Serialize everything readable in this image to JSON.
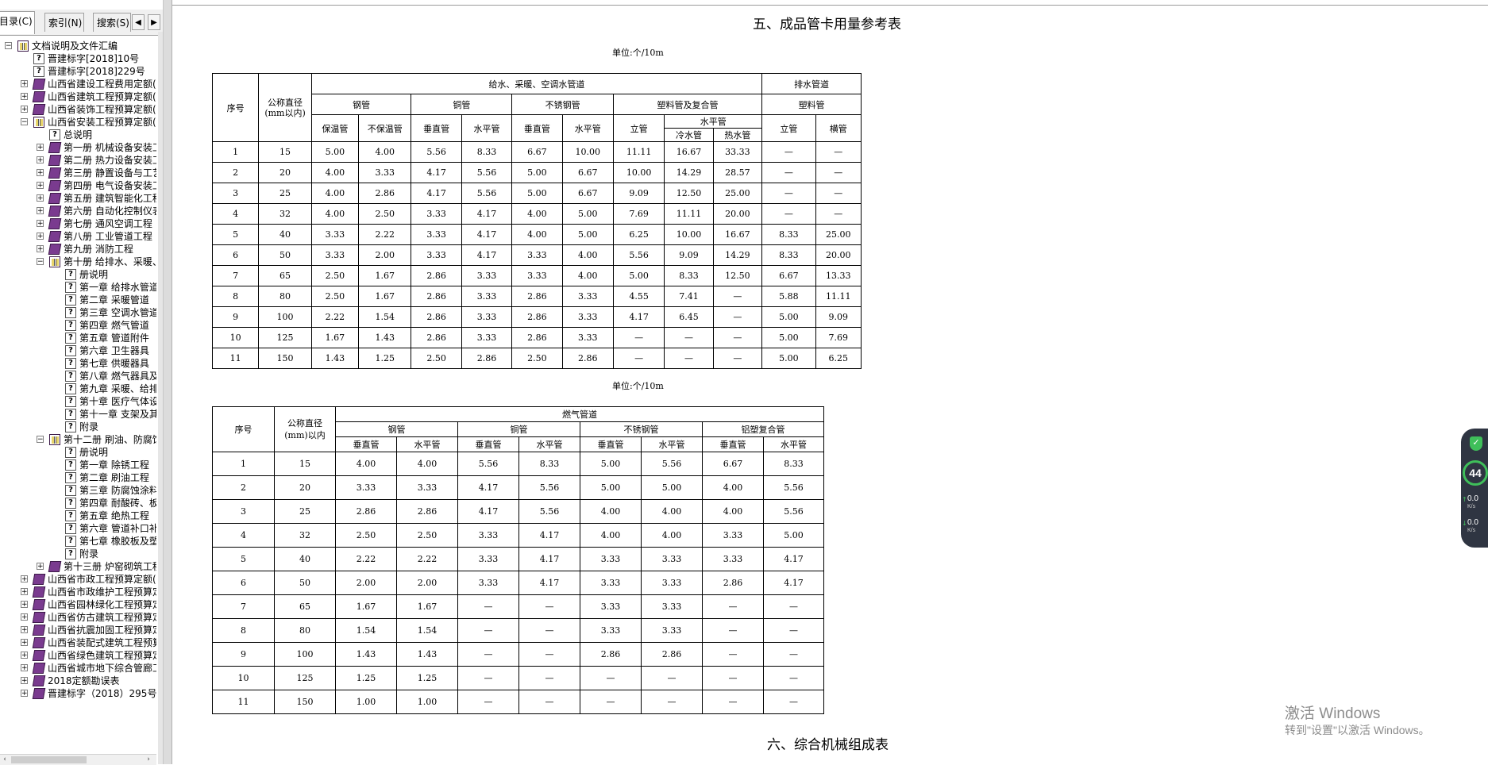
{
  "tabs": [
    {
      "label": "目录(C)",
      "active": true
    },
    {
      "label": "索引(N)",
      "active": false
    },
    {
      "label": "搜索(S)",
      "active": false
    }
  ],
  "tree": [
    {
      "level": 0,
      "toggle": "-",
      "icon": "book-open",
      "label": "文档说明及文件汇编"
    },
    {
      "level": 1,
      "toggle": "",
      "icon": "help",
      "label": "晋建标字[2018]10号"
    },
    {
      "level": 1,
      "toggle": "",
      "icon": "help",
      "label": "晋建标字[2018]229号"
    },
    {
      "level": 1,
      "toggle": "+",
      "icon": "book",
      "label": "山西省建设工程费用定额("
    },
    {
      "level": 1,
      "toggle": "+",
      "icon": "book",
      "label": "山西省建筑工程预算定额("
    },
    {
      "level": 1,
      "toggle": "+",
      "icon": "book",
      "label": "山西省装饰工程预算定额("
    },
    {
      "level": 1,
      "toggle": "-",
      "icon": "book-open",
      "label": "山西省安装工程预算定额("
    },
    {
      "level": 2,
      "toggle": "",
      "icon": "help",
      "label": "总说明"
    },
    {
      "level": 2,
      "toggle": "+",
      "icon": "book",
      "label": "第一册 机械设备安装工"
    },
    {
      "level": 2,
      "toggle": "+",
      "icon": "book",
      "label": "第二册 热力设备安装工"
    },
    {
      "level": 2,
      "toggle": "+",
      "icon": "book",
      "label": "第三册 静置设备与工艺"
    },
    {
      "level": 2,
      "toggle": "+",
      "icon": "book",
      "label": "第四册 电气设备安装工"
    },
    {
      "level": 2,
      "toggle": "+",
      "icon": "book",
      "label": "第五册 建筑智能化工程"
    },
    {
      "level": 2,
      "toggle": "+",
      "icon": "book",
      "label": "第六册 自动化控制仪表"
    },
    {
      "level": 2,
      "toggle": "+",
      "icon": "book",
      "label": "第七册 通风空调工程"
    },
    {
      "level": 2,
      "toggle": "+",
      "icon": "book",
      "label": "第八册 工业管道工程"
    },
    {
      "level": 2,
      "toggle": "+",
      "icon": "book",
      "label": "第九册 消防工程"
    },
    {
      "level": 2,
      "toggle": "-",
      "icon": "book-open",
      "label": "第十册 给排水、采暖、"
    },
    {
      "level": 3,
      "toggle": "",
      "icon": "help",
      "label": "册说明"
    },
    {
      "level": 3,
      "toggle": "",
      "icon": "help",
      "label": "第一章 给排水管道"
    },
    {
      "level": 3,
      "toggle": "",
      "icon": "help",
      "label": "第二章 采暖管道"
    },
    {
      "level": 3,
      "toggle": "",
      "icon": "help",
      "label": "第三章 空调水管道"
    },
    {
      "level": 3,
      "toggle": "",
      "icon": "help",
      "label": "第四章 燃气管道"
    },
    {
      "level": 3,
      "toggle": "",
      "icon": "help",
      "label": "第五章 管道附件"
    },
    {
      "level": 3,
      "toggle": "",
      "icon": "help",
      "label": "第六章 卫生器具"
    },
    {
      "level": 3,
      "toggle": "",
      "icon": "help",
      "label": "第七章 供暖器具"
    },
    {
      "level": 3,
      "toggle": "",
      "icon": "help",
      "label": "第八章 燃气器具及其"
    },
    {
      "level": 3,
      "toggle": "",
      "icon": "help",
      "label": "第九章 采暖、给排水"
    },
    {
      "level": 3,
      "toggle": "",
      "icon": "help",
      "label": "第十章 医疗气体设备"
    },
    {
      "level": 3,
      "toggle": "",
      "icon": "help",
      "label": "第十一章 支架及其他"
    },
    {
      "level": 3,
      "toggle": "",
      "icon": "help",
      "label": "附录"
    },
    {
      "level": 2,
      "toggle": "-",
      "icon": "book-open",
      "label": "第十二册 刷油、防腐蚀"
    },
    {
      "level": 3,
      "toggle": "",
      "icon": "help",
      "label": "册说明"
    },
    {
      "level": 3,
      "toggle": "",
      "icon": "help",
      "label": "第一章 除锈工程"
    },
    {
      "level": 3,
      "toggle": "",
      "icon": "help",
      "label": "第二章 刷油工程"
    },
    {
      "level": 3,
      "toggle": "",
      "icon": "help",
      "label": "第三章 防腐蚀涂料工"
    },
    {
      "level": 3,
      "toggle": "",
      "icon": "help",
      "label": "第四章 耐酸砖、板衬"
    },
    {
      "level": 3,
      "toggle": "",
      "icon": "help",
      "label": "第五章 绝热工程"
    },
    {
      "level": 3,
      "toggle": "",
      "icon": "help",
      "label": "第六章 管道补口补伤"
    },
    {
      "level": 3,
      "toggle": "",
      "icon": "help",
      "label": "第七章 橡胶板及塑料"
    },
    {
      "level": 3,
      "toggle": "",
      "icon": "help",
      "label": "附录"
    },
    {
      "level": 2,
      "toggle": "+",
      "icon": "book",
      "label": "第十三册 炉窑砌筑工程"
    },
    {
      "level": 1,
      "toggle": "+",
      "icon": "book",
      "label": "山西省市政工程预算定额("
    },
    {
      "level": 1,
      "toggle": "+",
      "icon": "book",
      "label": "山西省市政维护工程预算定"
    },
    {
      "level": 1,
      "toggle": "+",
      "icon": "book",
      "label": "山西省园林绿化工程预算定"
    },
    {
      "level": 1,
      "toggle": "+",
      "icon": "book",
      "label": "山西省仿古建筑工程预算定"
    },
    {
      "level": 1,
      "toggle": "+",
      "icon": "book",
      "label": "山西省抗震加固工程预算定"
    },
    {
      "level": 1,
      "toggle": "+",
      "icon": "book",
      "label": "山西省装配式建筑工程预算"
    },
    {
      "level": 1,
      "toggle": "+",
      "icon": "book",
      "label": "山西省绿色建筑工程预算定"
    },
    {
      "level": 1,
      "toggle": "+",
      "icon": "book",
      "label": "山西省城市地下综合管廊工"
    },
    {
      "level": 1,
      "toggle": "+",
      "icon": "book",
      "label": "2018定额勘误表"
    },
    {
      "level": 1,
      "toggle": "+",
      "icon": "book",
      "label": "晋建标字（2018）295号"
    }
  ],
  "doc": {
    "title": "五、成品管卡用量参考表",
    "unit1": "单位:个/10m",
    "unit2": "单位:个/10m",
    "next_title": "六、综合机械组成表"
  },
  "table1": {
    "h_seq": "序号",
    "h_dia": "公称直径\n(mm以内)",
    "h_group1": "给水、采暖、空调水管道",
    "h_group2": "排水管道",
    "h_steel": "钢管",
    "h_copper": "铜管",
    "h_stainless": "不锈钢管",
    "h_plastic": "塑料管及复合管",
    "h_drain_plastic": "塑料管",
    "h_insulated": "保温管",
    "h_uninsulated": "不保温管",
    "h_vertical1": "垂直管",
    "h_horizontal1": "水平管",
    "h_vertical2": "垂直管",
    "h_horizontal2": "水平管",
    "h_riser": "立管",
    "h_water_horizontal": "水平管",
    "h_cold": "冷水管",
    "h_hot": "热水管",
    "h_drain_riser": "立管",
    "h_drain_horizontal": "横管",
    "rows": [
      [
        "1",
        "15",
        "5.00",
        "4.00",
        "5.56",
        "8.33",
        "6.67",
        "10.00",
        "11.11",
        "16.67",
        "33.33",
        "—",
        "—"
      ],
      [
        "2",
        "20",
        "4.00",
        "3.33",
        "4.17",
        "5.56",
        "5.00",
        "6.67",
        "10.00",
        "14.29",
        "28.57",
        "—",
        "—"
      ],
      [
        "3",
        "25",
        "4.00",
        "2.86",
        "4.17",
        "5.56",
        "5.00",
        "6.67",
        "9.09",
        "12.50",
        "25.00",
        "—",
        "—"
      ],
      [
        "4",
        "32",
        "4.00",
        "2.50",
        "3.33",
        "4.17",
        "4.00",
        "5.00",
        "7.69",
        "11.11",
        "20.00",
        "—",
        "—"
      ],
      [
        "5",
        "40",
        "3.33",
        "2.22",
        "3.33",
        "4.17",
        "4.00",
        "5.00",
        "6.25",
        "10.00",
        "16.67",
        "8.33",
        "25.00"
      ],
      [
        "6",
        "50",
        "3.33",
        "2.00",
        "3.33",
        "4.17",
        "3.33",
        "4.00",
        "5.56",
        "9.09",
        "14.29",
        "8.33",
        "20.00"
      ],
      [
        "7",
        "65",
        "2.50",
        "1.67",
        "2.86",
        "3.33",
        "3.33",
        "4.00",
        "5.00",
        "8.33",
        "12.50",
        "6.67",
        "13.33"
      ],
      [
        "8",
        "80",
        "2.50",
        "1.67",
        "2.86",
        "3.33",
        "2.86",
        "3.33",
        "4.55",
        "7.41",
        "—",
        "5.88",
        "11.11"
      ],
      [
        "9",
        "100",
        "2.22",
        "1.54",
        "2.86",
        "3.33",
        "2.86",
        "3.33",
        "4.17",
        "6.45",
        "—",
        "5.00",
        "9.09"
      ],
      [
        "10",
        "125",
        "1.67",
        "1.43",
        "2.86",
        "3.33",
        "2.86",
        "3.33",
        "—",
        "—",
        "—",
        "5.00",
        "7.69"
      ],
      [
        "11",
        "150",
        "1.43",
        "1.25",
        "2.50",
        "2.86",
        "2.50",
        "2.86",
        "—",
        "—",
        "—",
        "5.00",
        "6.25"
      ]
    ]
  },
  "table2": {
    "h_seq": "序号",
    "h_dia": "公称直径\n(mm)以内",
    "h_group": "燃气管道",
    "h_steel": "钢管",
    "h_copper": "铜管",
    "h_stainless": "不锈钢管",
    "h_alplastic": "铝塑复合管",
    "h_sub": [
      "垂直管",
      "水平管",
      "垂直管",
      "水平管",
      "垂直管",
      "水平管",
      "垂直管",
      "水平管"
    ],
    "rows": [
      [
        "1",
        "15",
        "4.00",
        "4.00",
        "5.56",
        "8.33",
        "5.00",
        "5.56",
        "6.67",
        "8.33"
      ],
      [
        "2",
        "20",
        "3.33",
        "3.33",
        "4.17",
        "5.56",
        "5.00",
        "5.00",
        "4.00",
        "5.56"
      ],
      [
        "3",
        "25",
        "2.86",
        "2.86",
        "4.17",
        "5.56",
        "4.00",
        "4.00",
        "4.00",
        "5.56"
      ],
      [
        "4",
        "32",
        "2.50",
        "2.50",
        "3.33",
        "4.17",
        "4.00",
        "4.00",
        "3.33",
        "5.00"
      ],
      [
        "5",
        "40",
        "2.22",
        "2.22",
        "3.33",
        "4.17",
        "3.33",
        "3.33",
        "3.33",
        "4.17"
      ],
      [
        "6",
        "50",
        "2.00",
        "2.00",
        "3.33",
        "4.17",
        "3.33",
        "3.33",
        "2.86",
        "4.17"
      ],
      [
        "7",
        "65",
        "1.67",
        "1.67",
        "—",
        "—",
        "3.33",
        "3.33",
        "—",
        "—"
      ],
      [
        "8",
        "80",
        "1.54",
        "1.54",
        "—",
        "—",
        "3.33",
        "3.33",
        "—",
        "—"
      ],
      [
        "9",
        "100",
        "1.43",
        "1.43",
        "—",
        "—",
        "2.86",
        "2.86",
        "—",
        "—"
      ],
      [
        "10",
        "125",
        "1.25",
        "1.25",
        "—",
        "—",
        "—",
        "—",
        "—",
        "—"
      ],
      [
        "11",
        "150",
        "1.00",
        "1.00",
        "—",
        "—",
        "—",
        "—",
        "—",
        "—"
      ]
    ]
  },
  "watermark": {
    "line1": "激活 Windows",
    "line2": "转到\"设置\"以激活 Windows。"
  },
  "widget": {
    "cpu": "44",
    "cpu_unit": "%",
    "up": "0.0",
    "up_unit": "K/s",
    "down": "0.0",
    "down_unit": "K/s"
  }
}
